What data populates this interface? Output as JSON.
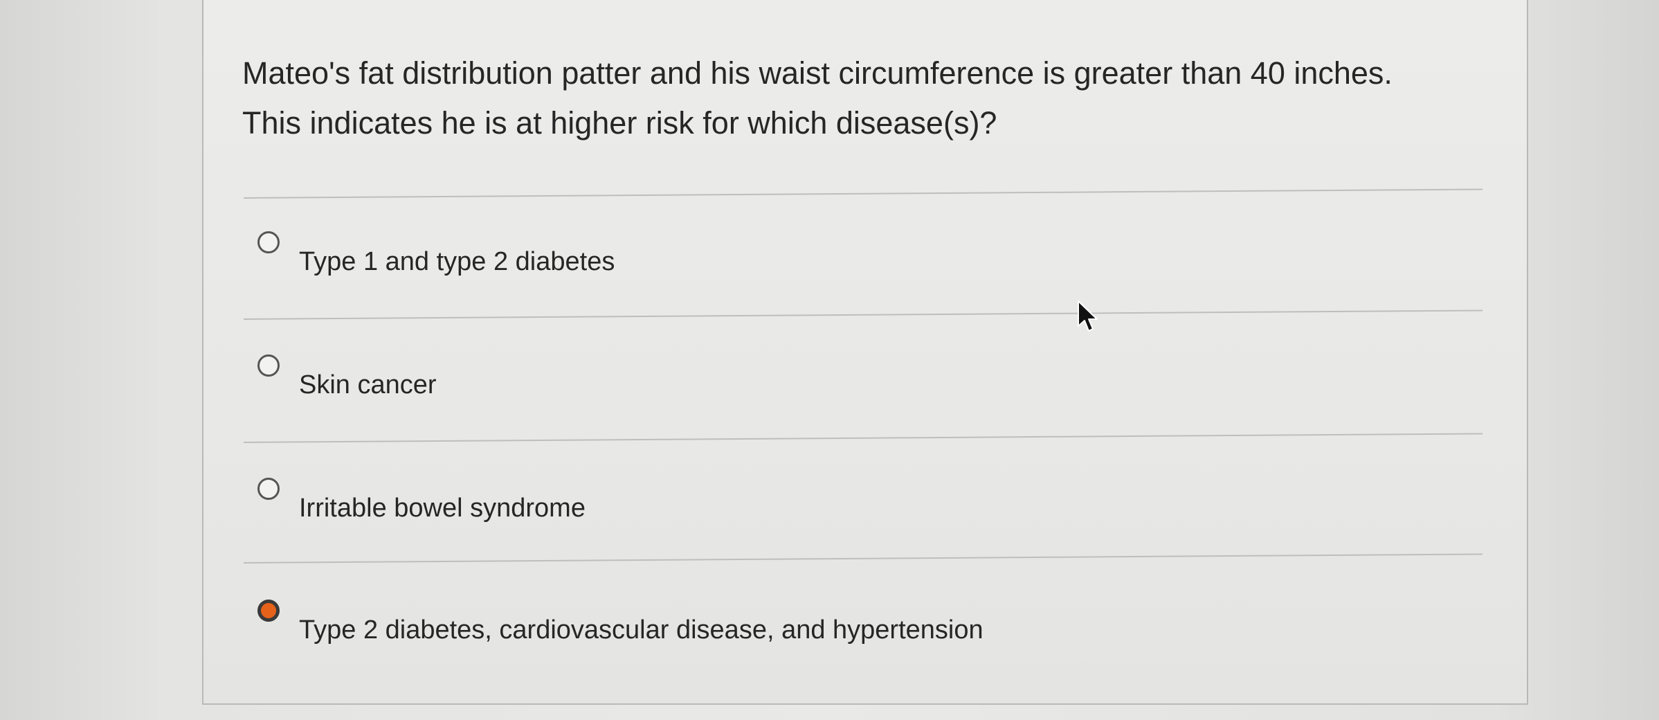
{
  "question": {
    "text": "Mateo's fat distribution patter and his waist circumference is greater than 40 inches. This indicates he is at higher risk for which disease(s)?"
  },
  "options": [
    {
      "label": "Type 1 and type 2 diabetes",
      "selected": false
    },
    {
      "label": "Skin cancer",
      "selected": false
    },
    {
      "label": "Irritable bowel syndrome",
      "selected": false
    },
    {
      "label": "Type 2 diabetes, cardiovascular disease, and hypertension",
      "selected": true
    }
  ],
  "colors": {
    "selected_radio": "#e5621a",
    "text": "#262626",
    "divider": "#bebebc"
  },
  "icons": {
    "cursor": "mouse-pointer-arrow"
  }
}
